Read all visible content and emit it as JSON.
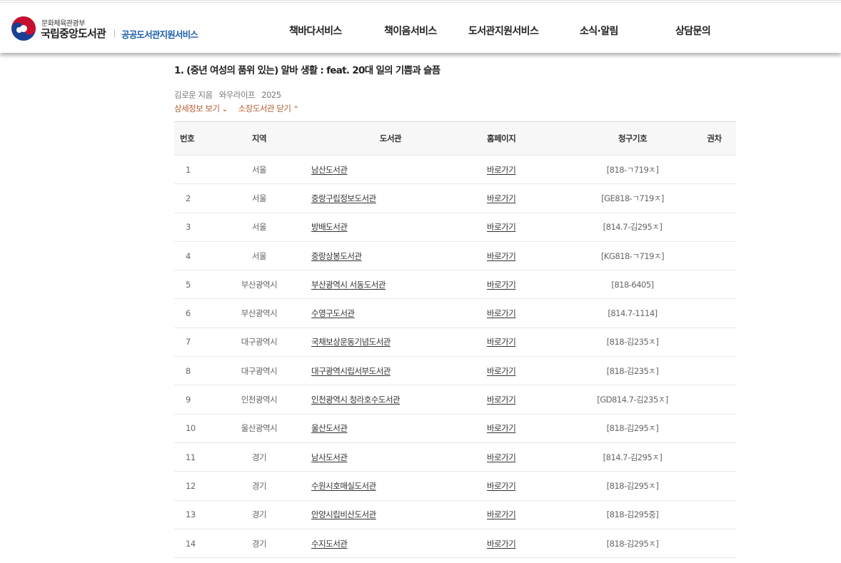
{
  "header": {
    "ministry": "문화체육관광부",
    "org": "국립중앙도서관",
    "service": "공공도서관지원서비스",
    "nav": [
      "책바다서비스",
      "책이음서비스",
      "도서관지원서비스",
      "소식·알림",
      "상담문의"
    ]
  },
  "book": {
    "title": "1. (중년 여성의 품위 있는) 알바 생활 : feat. 20대 일의 기쁨과 슬픔",
    "author": "김로운 지음",
    "publisher": "와우라이프",
    "year": "2025",
    "detail_link": "상세정보 보기",
    "holding_link": "소장도서관 닫기"
  },
  "table": {
    "headers": [
      "번호",
      "지역",
      "도서관",
      "홈페이지",
      "청구기호",
      "권차"
    ],
    "rows": [
      {
        "no": "1",
        "region": "서울",
        "library": "남산도서관",
        "homepage": "바로가기",
        "call": "[818-ㄱ719ㅈ]",
        "vol": ""
      },
      {
        "no": "2",
        "region": "서울",
        "library": "중랑구립정보도서관",
        "homepage": "바로가기",
        "call": "[GE818-ㄱ719ㅈ]",
        "vol": ""
      },
      {
        "no": "3",
        "region": "서울",
        "library": "방배도서관",
        "homepage": "바로가기",
        "call": "[814.7-김295ㅈ]",
        "vol": ""
      },
      {
        "no": "4",
        "region": "서울",
        "library": "중랑상봉도서관",
        "homepage": "바로가기",
        "call": "[KG818-ㄱ719ㅈ]",
        "vol": ""
      },
      {
        "no": "5",
        "region": "부산광역시",
        "library": "부산광역시 서동도서관",
        "homepage": "바로가기",
        "call": "[818-6405]",
        "vol": ""
      },
      {
        "no": "6",
        "region": "부산광역시",
        "library": "수영구도서관",
        "homepage": "바로가기",
        "call": "[814.7-1114]",
        "vol": ""
      },
      {
        "no": "7",
        "region": "대구광역시",
        "library": "국채보상운동기념도서관",
        "homepage": "바로가기",
        "call": "[818-김235ㅈ]",
        "vol": ""
      },
      {
        "no": "8",
        "region": "대구광역시",
        "library": "대구광역시립서부도서관",
        "homepage": "바로가기",
        "call": "[818-김235ㅈ]",
        "vol": ""
      },
      {
        "no": "9",
        "region": "인천광역시",
        "library": "인천광역시 청라호수도서관",
        "homepage": "바로가기",
        "call": "[GD814.7-김235ㅈ]",
        "vol": ""
      },
      {
        "no": "10",
        "region": "울산광역시",
        "library": "울산도서관",
        "homepage": "바로가기",
        "call": "[818-김295ㅈ]",
        "vol": ""
      },
      {
        "no": "11",
        "region": "경기",
        "library": "남사도서관",
        "homepage": "바로가기",
        "call": "[814.7-김295ㅈ]",
        "vol": ""
      },
      {
        "no": "12",
        "region": "경기",
        "library": "수원시호매실도서관",
        "homepage": "바로가기",
        "call": "[818-김295ㅈ]",
        "vol": ""
      },
      {
        "no": "13",
        "region": "경기",
        "library": "안양시립비산도서관",
        "homepage": "바로가기",
        "call": "[818-김295중]",
        "vol": ""
      },
      {
        "no": "14",
        "region": "경기",
        "library": "수지도서관",
        "homepage": "바로가기",
        "call": "[818-김295ㅈ]",
        "vol": ""
      }
    ]
  },
  "colors": {
    "accent_link": "#b35c32",
    "service_blue": "#1b5cab",
    "logo_red": "#c8102e",
    "logo_blue": "#1c3f94"
  }
}
